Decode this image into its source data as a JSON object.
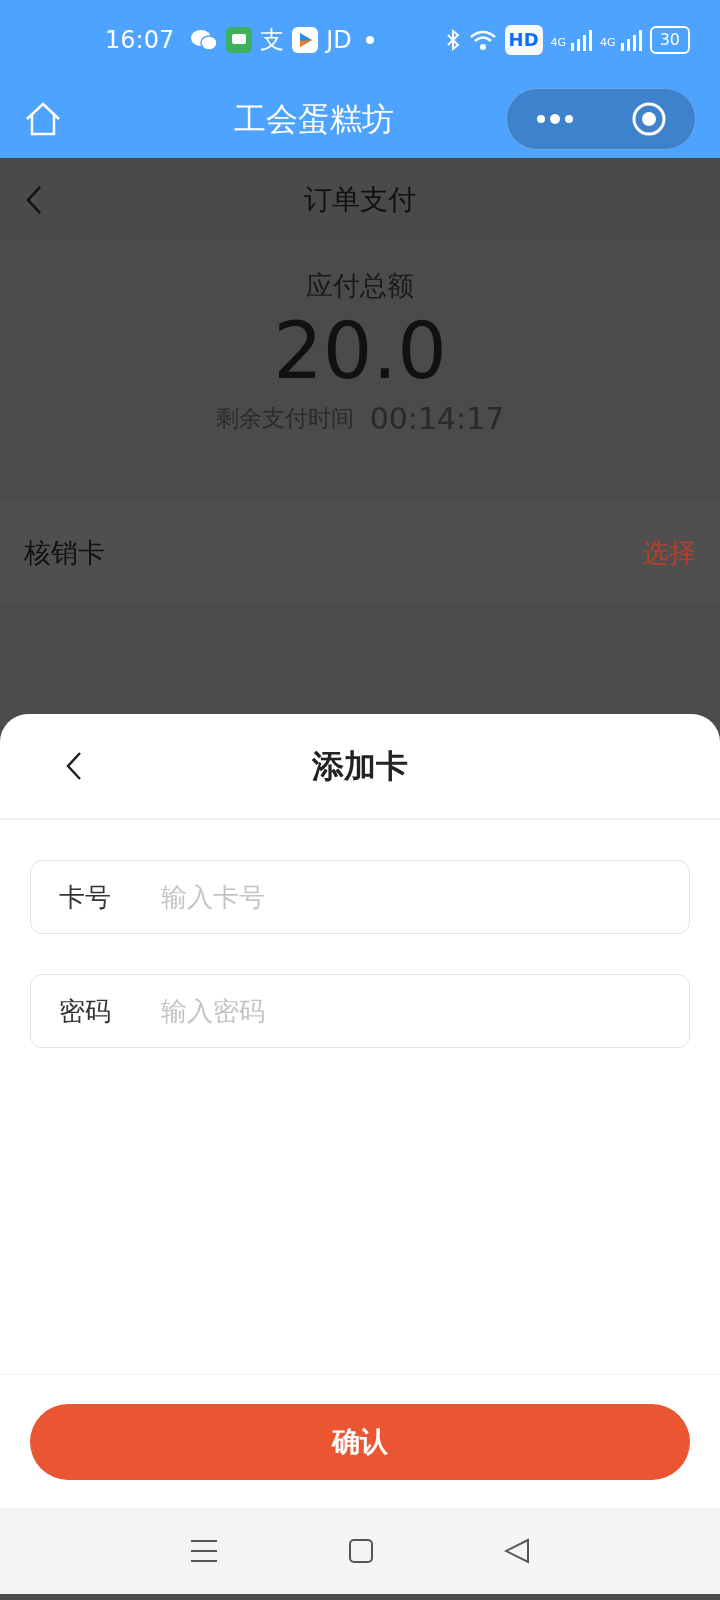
{
  "status_bar": {
    "time": "16:07",
    "app_glyphs": [
      "支",
      "JD"
    ],
    "hd_label": "HD",
    "network_labels": [
      "4G",
      "4G"
    ],
    "battery": "30"
  },
  "mini_program_bar": {
    "title": "工会蛋糕坊"
  },
  "page": {
    "title": "订单支付",
    "amount_label": "应付总额",
    "amount": "20.0",
    "timer_label": "剩余支付时间",
    "timer": "00:14:17",
    "card_row": {
      "label": "核销卡",
      "action": "选择"
    }
  },
  "sheet": {
    "title": "添加卡",
    "fields": [
      {
        "label": "卡号",
        "placeholder": "输入卡号"
      },
      {
        "label": "密码",
        "placeholder": "输入密码"
      }
    ],
    "confirm_button": "确认"
  }
}
